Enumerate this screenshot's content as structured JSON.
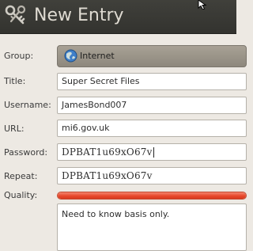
{
  "window": {
    "title": "New Entry",
    "app_icon": "keys-icon",
    "pointer": "mouse-pointer-icon"
  },
  "form": {
    "group": {
      "label": "Group:",
      "value": "Internet",
      "icon": "globe-icon"
    },
    "title": {
      "label": "Title:",
      "value": "Super Secret Files"
    },
    "username": {
      "label": "Username:",
      "value": "JamesBond007"
    },
    "url": {
      "label": "URL:",
      "value": "mi6.gov.uk"
    },
    "password": {
      "label": "Password:",
      "value": "DPBAT1u69xO67v"
    },
    "repeat": {
      "label": "Repeat:",
      "value": "DPBAT1u69xO67v"
    },
    "quality": {
      "label": "Quality:",
      "level": 1.0
    },
    "notes": {
      "value": "Need to know basis only."
    }
  },
  "colors": {
    "titlebar": "#3a3a36",
    "title_text": "#dfdbd2",
    "background": "#ede9e3",
    "quality_fill": "#e8492c"
  }
}
